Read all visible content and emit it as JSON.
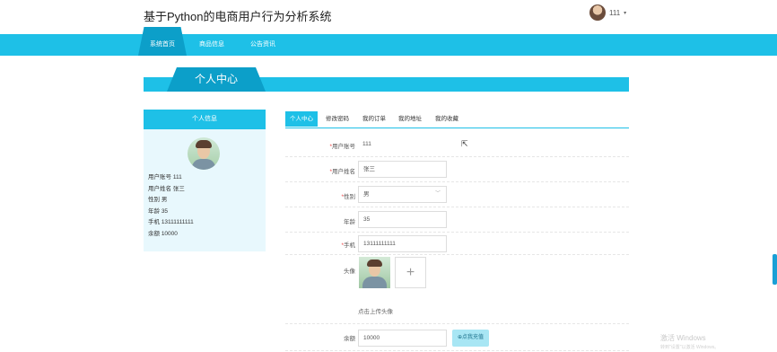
{
  "header": {
    "site_title": "基于Python的电商用户行为分析系统",
    "user_name": "111",
    "caret": "▾"
  },
  "nav": {
    "items": [
      "系统首页",
      "商品信息",
      "公告资讯"
    ],
    "active": "系统首页"
  },
  "banner": {
    "title": "个人中心"
  },
  "sidebar": {
    "header": "个人信息",
    "fields": [
      {
        "label": "用户账号",
        "value": "111"
      },
      {
        "label": "用户姓名",
        "value": "张三"
      },
      {
        "label": "性别",
        "value": "男"
      },
      {
        "label": "年龄",
        "value": "35"
      },
      {
        "label": "手机",
        "value": "13111111111"
      },
      {
        "label": "余额",
        "value": "10000"
      }
    ]
  },
  "tabs": {
    "items": [
      "个人中心",
      "修改密码",
      "我的订单",
      "我的地址",
      "我的收藏"
    ],
    "active": "个人中心"
  },
  "form": {
    "account_label": "用户账号",
    "account_value": "111",
    "name_label": "用户姓名",
    "name_value": "张三",
    "gender_label": "性别",
    "gender_value": "男",
    "age_label": "年龄",
    "age_value": "35",
    "phone_label": "手机",
    "phone_value": "13111111111",
    "avatar_label": "头像",
    "upload_plus": "+",
    "upload_hint": "点击上传头像",
    "balance_label": "余额",
    "balance_value": "10000",
    "recharge_button": "⊕点我充值",
    "required_mark": "*"
  },
  "watermark": {
    "line1": "激活 Windows",
    "line2": "转到\"设置\"以激活 Windows。"
  },
  "colors": {
    "accent": "#1ec0e7",
    "accent_dark": "#0c9fc9",
    "panel_bg": "#e8f8fd"
  }
}
